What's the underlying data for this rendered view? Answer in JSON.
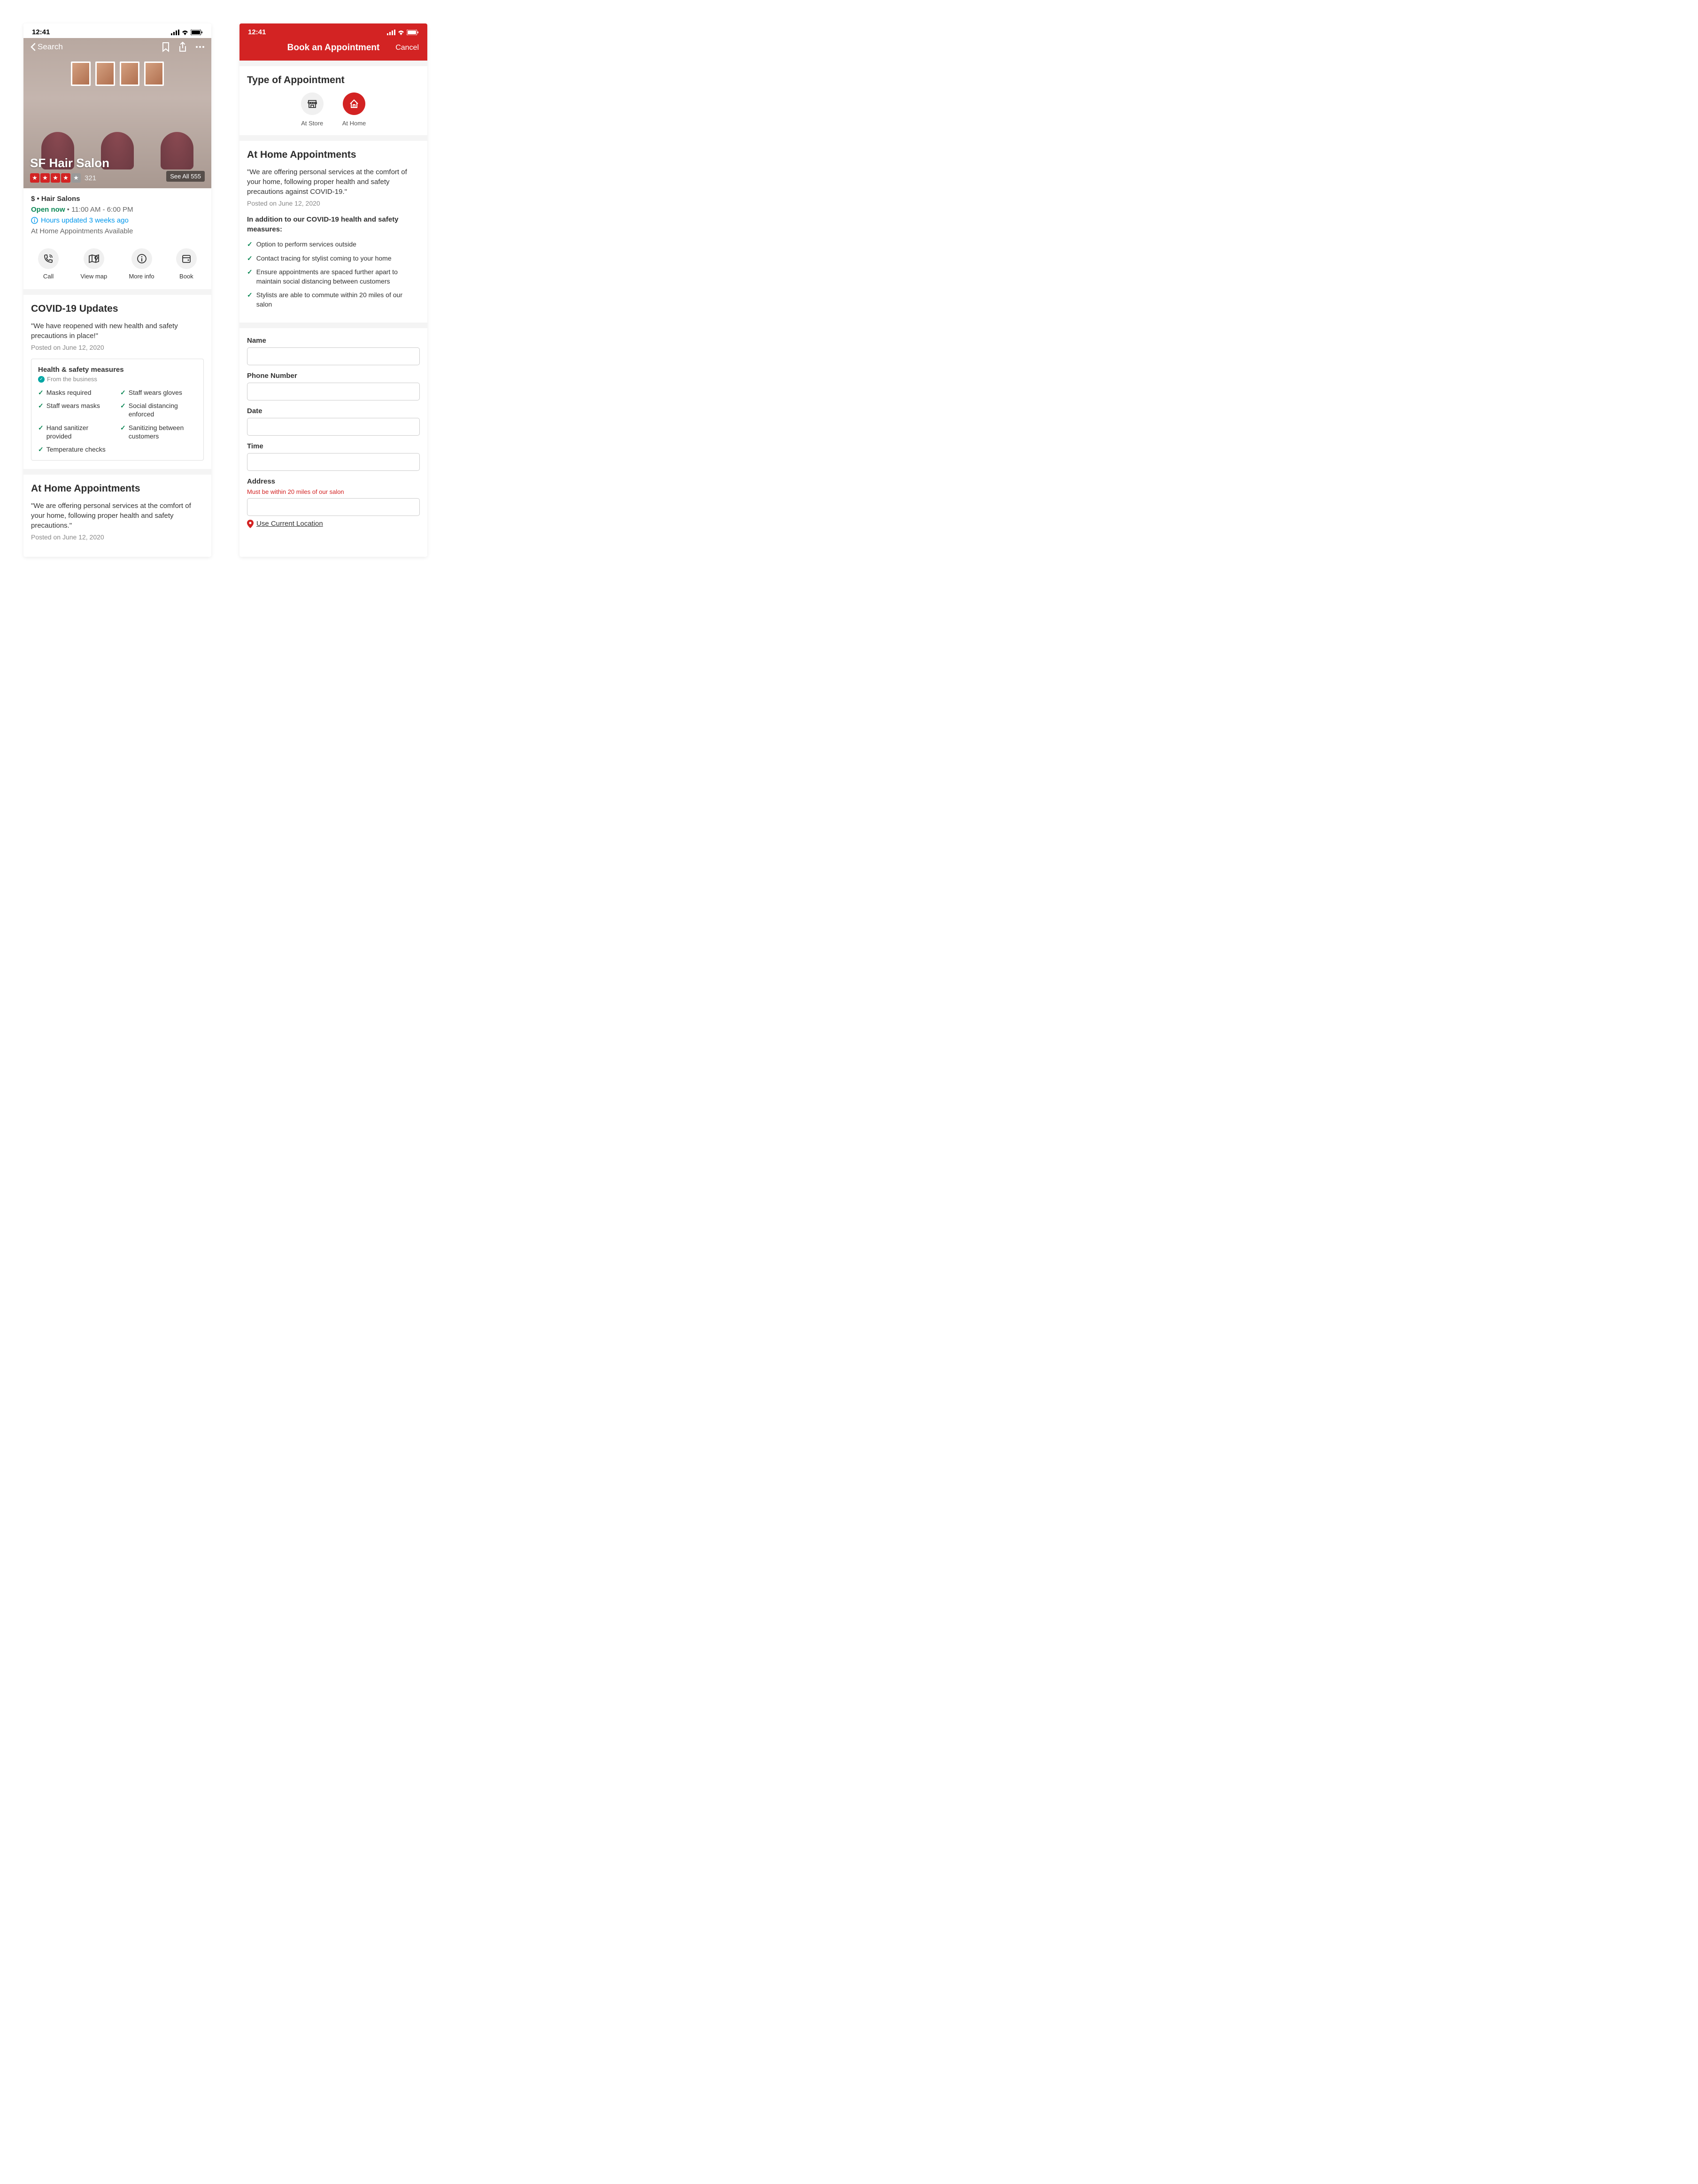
{
  "status_time": "12:41",
  "phone1": {
    "back_label": "Search",
    "business_name": "SF Hair Salon",
    "rating_stars": 4,
    "review_count": "321",
    "see_all_label": "See All 555",
    "price_category": "$ • Hair Salons",
    "open_now": "Open now",
    "hours_range": " • 11:00 AM - 6:00 PM",
    "hours_updated": "Hours updated 3 weeks ago",
    "at_home_avail": "At Home Appointments Available",
    "actions": {
      "call": "Call",
      "map": "View map",
      "more": "More info",
      "book": "Book"
    },
    "covid": {
      "title": "COVID-19 Updates",
      "quote": "\"We have reopened with new health and safety precautions in place!\"",
      "posted": "Posted on June 12, 2020",
      "measures_title": "Health & safety measures",
      "from_business": "From the business",
      "measures": [
        "Masks required",
        "Staff wears gloves",
        "Staff wears masks",
        "Social distancing enforced",
        "Hand sanitizer provided",
        "Sanitizing between customers",
        "Temperature checks"
      ]
    },
    "at_home": {
      "title": "At Home Appointments",
      "quote": "\"We are offering personal services at the comfort of your home, following proper health and safety precautions.\"",
      "posted": "Posted on June 12, 2020"
    }
  },
  "phone2": {
    "modal_title": "Book an Appointment",
    "cancel": "Cancel",
    "type_title": "Type of Appointment",
    "type_store": "At Store",
    "type_home": "At Home",
    "at_home": {
      "title": "At Home Appointments",
      "quote": "\"We are offering personal services at the comfort of your home, following proper health and safety precautions against COVID-19.\"",
      "posted": "Posted on June 12, 2020",
      "subheading": "In addition to our COVID-19 health and safety measures:",
      "items": [
        "Option to perform services outside",
        "Contact tracing for stylist coming to your home",
        "Ensure appointments are spaced further apart to maintain social distancing between customers",
        "Stylists are able to commute within 20 miles of our salon"
      ]
    },
    "form": {
      "name_label": "Name",
      "phone_label": "Phone Number",
      "date_label": "Date",
      "time_label": "Time",
      "address_label": "Address",
      "address_hint": "Must be within 20 miles of our salon",
      "use_location": "Use Current Location"
    }
  }
}
